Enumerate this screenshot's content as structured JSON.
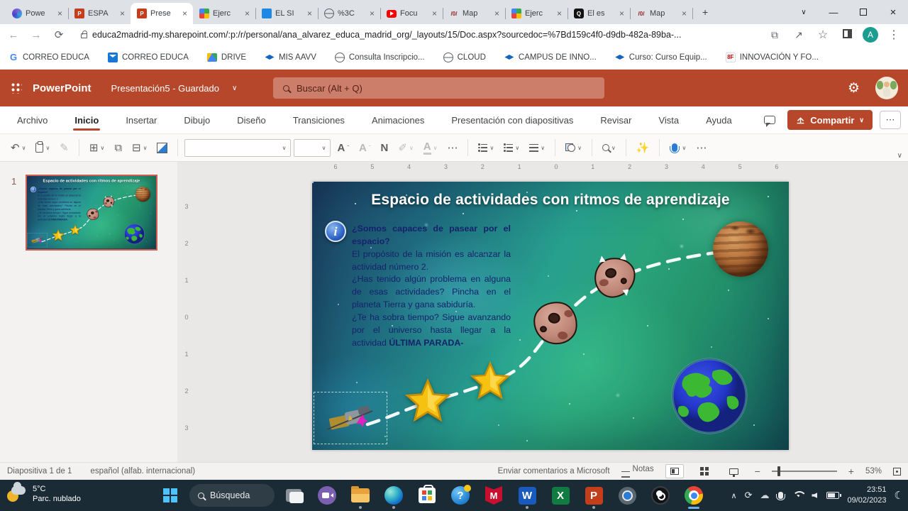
{
  "browser": {
    "tabs": [
      {
        "title": "Powe",
        "icon": "swirl-icon"
      },
      {
        "title": "ESPA",
        "icon": "powerpoint-icon"
      },
      {
        "title": "Prese",
        "icon": "powerpoint-icon"
      },
      {
        "title": "Ejerc",
        "icon": "color-grid-icon"
      },
      {
        "title": "EL SI",
        "icon": "blue-doc-icon"
      },
      {
        "title": "%3C",
        "icon": "globe-icon"
      },
      {
        "title": "Focu",
        "icon": "youtube-icon"
      },
      {
        "title": "Map",
        "icon": "genially-icon"
      },
      {
        "title": "Ejerc",
        "icon": "color-grid-icon"
      },
      {
        "title": "El es",
        "icon": "q-icon"
      },
      {
        "title": "Map",
        "icon": "genially-icon"
      }
    ],
    "genially_icon_text": "/0/",
    "q_icon_text": "Q",
    "new_tab": "+",
    "url": "educa2madrid-my.sharepoint.com/:p:/r/personal/ana_alvarez_educa_madrid_org/_layouts/15/Doc.aspx?sourcedoc=%7Bd159c4f0-d9db-482a-89ba-...",
    "avatar_letter": "A",
    "bookmarks": [
      {
        "label": "CORREO EDUCA",
        "icon": "google-g-icon"
      },
      {
        "label": "CORREO EDUCA",
        "icon": "envelope-icon"
      },
      {
        "label": "DRIVE",
        "icon": "drive-icon"
      },
      {
        "label": "MIS AAVV",
        "icon": "grad-cap-icon"
      },
      {
        "label": "Consulta Inscripcio...",
        "icon": "globe-icon"
      },
      {
        "label": "CLOUD",
        "icon": "globe-icon"
      },
      {
        "label": "CAMPUS DE INNO...",
        "icon": "grad-cap-icon"
      },
      {
        "label": "Curso: Curso Equip...",
        "icon": "grad-cap-icon"
      },
      {
        "label": "INNOVACIÓN Y FO...",
        "icon": "8f-icon"
      }
    ],
    "google_g": "G",
    "innovation_icon_text": "8F"
  },
  "app_header": {
    "app_name": "PowerPoint",
    "doc_title": "Presentación5  -  Guardado",
    "search_placeholder": "Buscar (Alt + Q)"
  },
  "ribbon": {
    "tabs": [
      "Archivo",
      "Inicio",
      "Insertar",
      "Dibujo",
      "Diseño",
      "Transiciones",
      "Animaciones",
      "Presentación con diapositivas",
      "Revisar",
      "Vista",
      "Ayuda"
    ],
    "active_tab": "Inicio",
    "share_label": "Compartir"
  },
  "toolbar": {
    "bold_label": "N",
    "grow_label": "A",
    "shrink_label": "A",
    "font_color_label": "A",
    "more": "⋯"
  },
  "rulers": {
    "horizontal": [
      "6",
      "5",
      "4",
      "3",
      "2",
      "1",
      "0",
      "1",
      "2",
      "3",
      "4",
      "5",
      "6"
    ],
    "vertical": [
      "3",
      "2",
      "1",
      "0",
      "1",
      "2",
      "3"
    ]
  },
  "thumbnail_panel": {
    "slide_number": "1"
  },
  "slide": {
    "title": "Espacio de actividades con ritmos de aprendizaje",
    "info_letter": "i",
    "body_bold_intro": "¿Somos capaces de pasear por el espacio?",
    "body_line2": "El propósito de la misión es alcanzar la actividad número 2.",
    "body_line3": " ¿Has tenido algún problema en alguna de esas actividades? Pincha en el planeta Tierra y gana sabiduría.",
    "body_line4": "¿Te ha sobra tiempo? Sigue avanzando por el universo hasta llegar a la actividad ",
    "body_bold_end": "ÚLTIMA PARADA-"
  },
  "status_bar": {
    "slide_info": "Diapositiva 1 de 1",
    "language": "español (alfab. internacional)",
    "feedback": "Enviar comentarios a Microsoft",
    "notes_label": "Notas",
    "zoom_level": "53%"
  },
  "taskbar": {
    "weather_temp": "5°C",
    "weather_desc": "Parc. nublado",
    "search_label": "Búsqueda",
    "mcafee_letter": "M",
    "word_letter": "W",
    "excel_letter": "X",
    "ppt_letter": "P",
    "help_letter": "?",
    "clock_time": "23:51",
    "clock_date": "09/02/2023"
  }
}
